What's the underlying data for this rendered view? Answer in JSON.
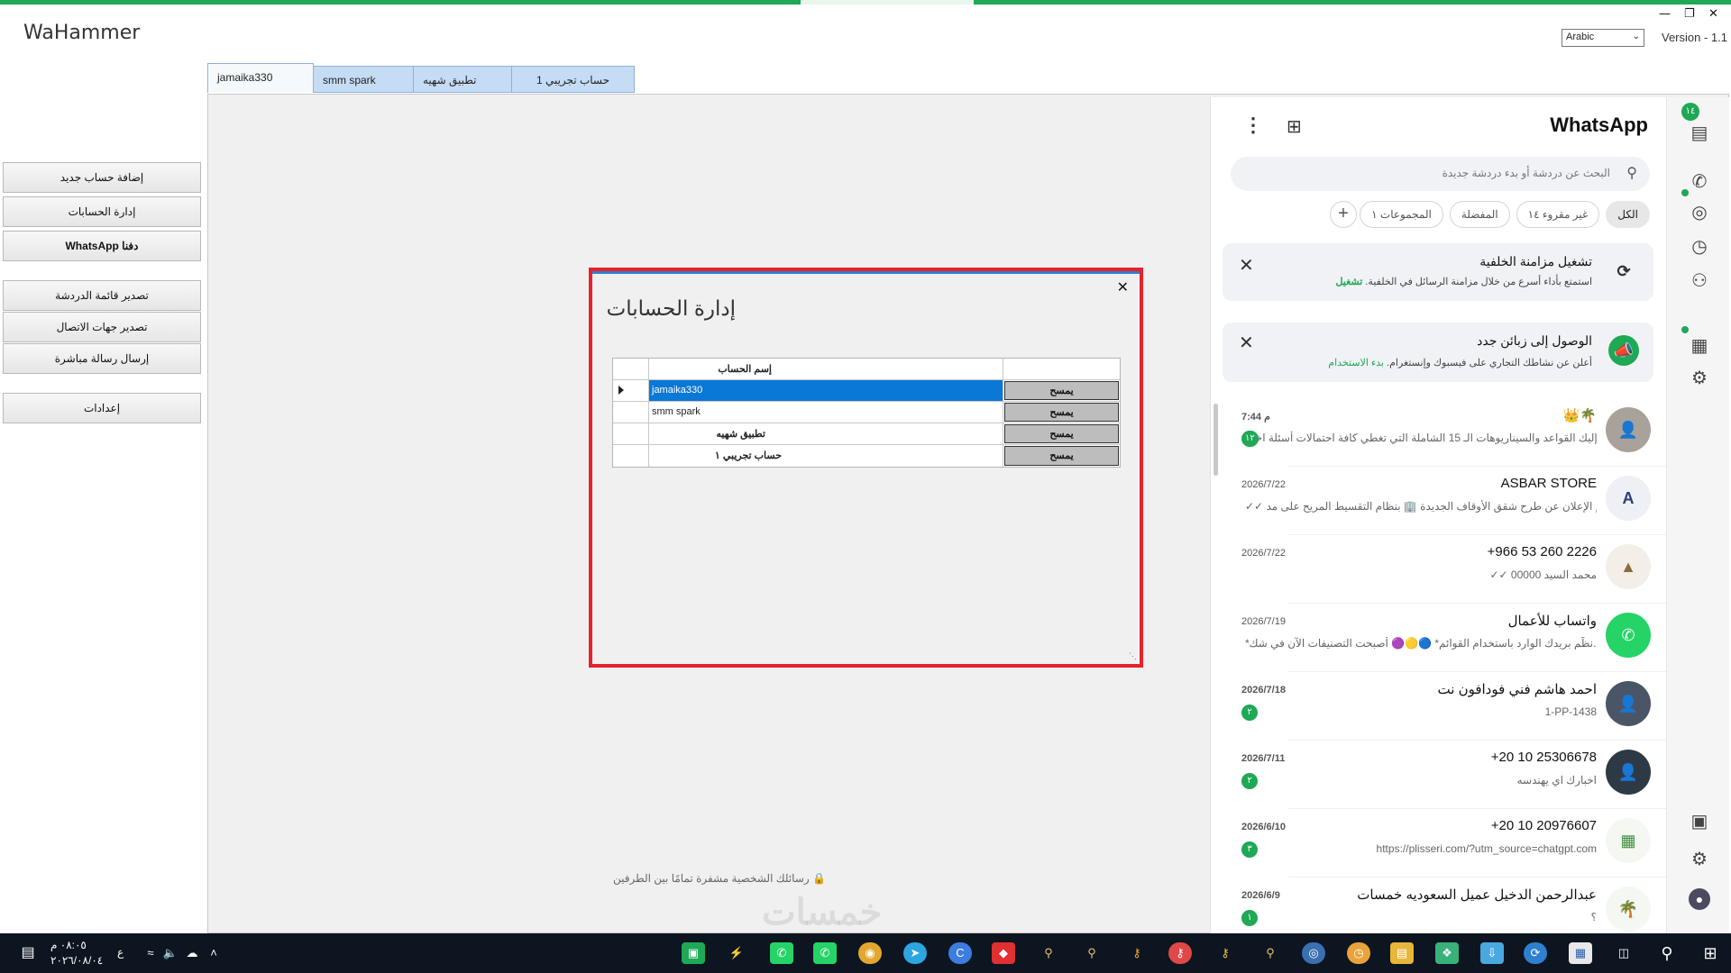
{
  "app": {
    "title": "WaHammer",
    "language": "Arabic",
    "version": "Version - 1.1",
    "window_controls": [
      "—",
      "❐",
      "✕"
    ]
  },
  "tabs": [
    "jamaika330",
    "smm spark",
    "تطبيق شهيه",
    "حساب تجريبي 1"
  ],
  "sidebar": {
    "add_account": "إضافة حساب جديد",
    "manage_accounts": "إدارة الحسابات",
    "whatsapp_menu": "WhatsApp دفنا",
    "export_chats": "تصدير قائمة الدردشة",
    "export_contacts": "تصدير جهات الاتصال",
    "send_direct": "إرسال رسالة مباشرة",
    "settings": "إعدادات"
  },
  "footer_note": "رسائلك الشخصية مشفرة تمامًا بين الطرفين",
  "whatsapp": {
    "title": "WhatsApp",
    "search_placeholder": "البحث عن دردشة أو بدء دردشة جديدة",
    "rail_badge": "١٤",
    "filters": [
      "الكل",
      "غير مقروء ١٤",
      "المفضلة",
      "المجموعات ١"
    ],
    "banner_sync": {
      "title": "تشغيل مزامنة الخلفية",
      "subtitle": "استمتع بأداء أسرع من خلال مزامنة الرسائل في الخلفية.",
      "action": "تشغيل"
    },
    "banner_reach": {
      "title": "الوصول إلى زبائن جدد",
      "subtitle": "أعلن عن نشاطك التجاري على فيسبوك وإنستغرام.",
      "action": "بدء الاستخدام"
    },
    "chats": [
      {
        "name": "👑🌴",
        "preview": "إليك القواعد والسيناريوهات الـ 15 الشاملة التي تغطي كافة احتمالات أسئلة اخت...",
        "time": "7:44 م",
        "unread": "١٢"
      },
      {
        "name": "ASBAR STORE",
        "preview": "✓✓ تم الإعلان عن طرح شقق الأوقاف الجديدة 🏢 بنظام التقسيط المريح على مد...",
        "time": "2026/7/22",
        "unread": ""
      },
      {
        "name": "+966 53 260 2226",
        "preview": "✓✓ محمد السيد 00000",
        "time": "2026/7/22",
        "unread": ""
      },
      {
        "name": "واتساب للأعمال",
        "preview": "*نظّم بريدك الوارد باستخدام القوائم* 🔵🟡🟣 أصبحت التصنيفات الآن في شك...",
        "time": "2026/7/19",
        "unread": ""
      },
      {
        "name": "احمد هاشم فني فودافون نت",
        "preview": "1-PP-1438",
        "time": "2026/7/18",
        "unread": "٢"
      },
      {
        "name": "+20 10 25306678",
        "preview": "اخبارك اي يهندسه",
        "time": "2026/7/11",
        "unread": "٢"
      },
      {
        "name": "+20 10 20976607",
        "preview": "https://plisseri.com/?utm_source=chatgpt.com",
        "time": "2026/6/10",
        "unread": "٣"
      },
      {
        "name": "عبدالرحمن الدخيل عميل السعوديه خمسات",
        "preview": "؟",
        "time": "2026/6/9",
        "unread": "١"
      }
    ]
  },
  "modal": {
    "title": "إدارة الحسابات",
    "close": "✕",
    "column_header": "إسم الحساب",
    "delete_label": "يمسح",
    "rows": [
      "jamaika330",
      "smm spark",
      "تطبيق شهيه",
      "حساب تجريبي ١"
    ],
    "selected_row": 0
  },
  "taskbar": {
    "time": "٠٨:٠٥ م",
    "date": "٢٠٢٦/٠٨/٠٤",
    "lang_indicator": "ع"
  },
  "colors": {
    "whatsapp_green": "#1fa855",
    "modal_border": "#e8212c",
    "selection_blue": "#0a78d7"
  }
}
